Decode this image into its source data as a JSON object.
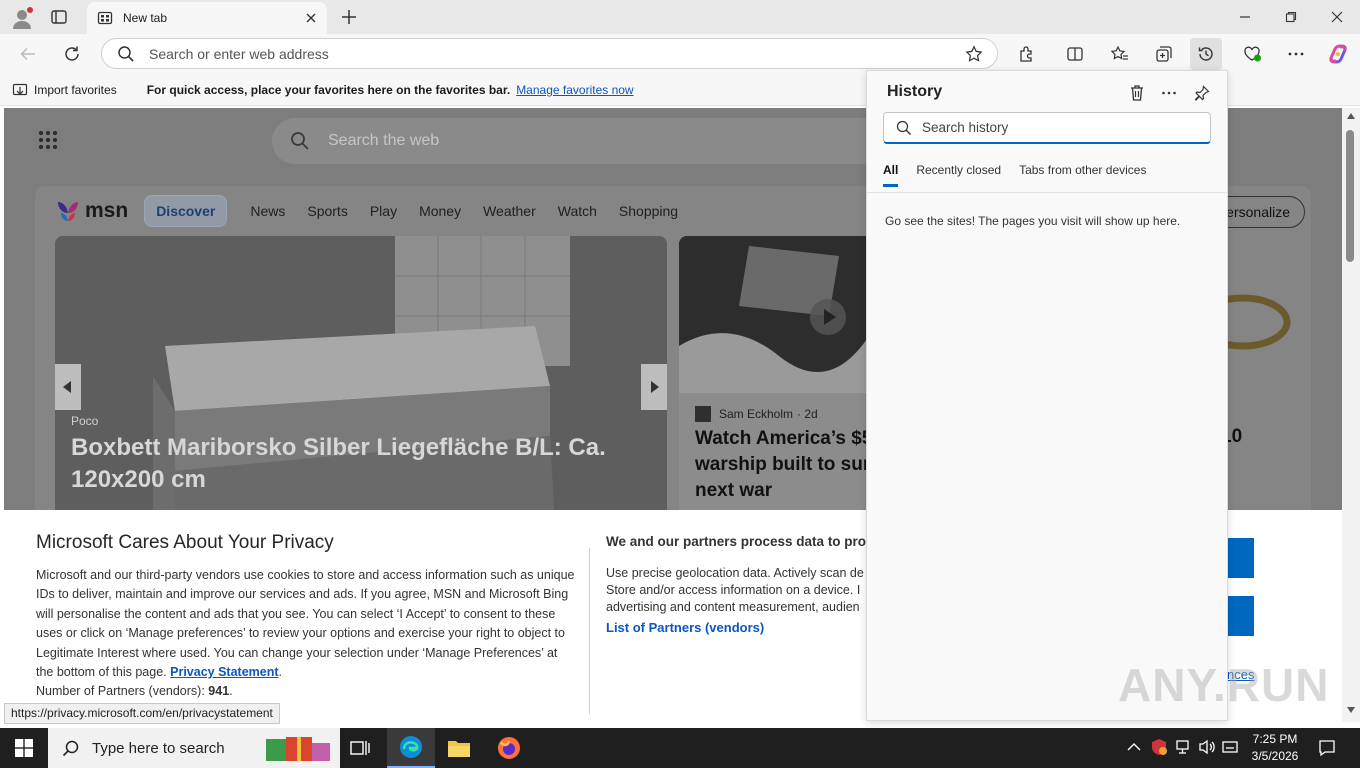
{
  "browser": {
    "tab_title": "New tab",
    "address_placeholder": "Search or enter web address"
  },
  "favorites_bar": {
    "import_label": "Import favorites",
    "message": "For quick access, place your favorites here on the favorites bar.",
    "manage_link": "Manage favorites now"
  },
  "msn": {
    "search_placeholder": "Search the web",
    "logo_text": "msn",
    "nav": [
      "Discover",
      "News",
      "Sports",
      "Play",
      "Money",
      "Weather",
      "Watch",
      "Shopping"
    ],
    "personalize_label": "Personalize",
    "hero": {
      "source": "Poco",
      "title": "Boxbett Mariborsko Silber Liegefläche B/L: Ca. 120x200 cm"
    },
    "video": {
      "author": "Sam Eckholm",
      "age": "· 2d",
      "title_lines": [
        "Watch America’s $5",
        "warship built to sur",
        "next war"
      ]
    },
    "right_card_fragment": "10"
  },
  "privacy": {
    "title": "Microsoft Cares About Your Privacy",
    "body": "Microsoft and our third-party vendors use cookies to store and access information such as unique IDs to deliver, maintain and improve our services and ads. If you agree, MSN and Microsoft Bing will personalise the content and ads that you see. You can select ‘I Accept’ to consent to these uses or click on ‘Manage preferences’ to review your options and exercise your right to object to Legitimate Interest where used.  You can change your selection under ‘Manage Preferences’ at the bottom of this page.",
    "privacy_link": "Privacy Statement",
    "partners_count_label": "Number of Partners (vendors):",
    "partners_count": "941",
    "partners_heading": "We and our partners process data to prov",
    "partners_lines": [
      "Use precise geolocation data. Actively scan de",
      "Store and/or access information on a device. I",
      "advertising and content measurement, audien"
    ],
    "partners_link": "List of Partners (vendors)",
    "prefs_link_fragment": "nces"
  },
  "status_url": "https://privacy.microsoft.com/en/privacystatement",
  "history": {
    "title": "History",
    "search_placeholder": "Search history",
    "tabs": [
      "All",
      "Recently closed",
      "Tabs from other devices"
    ],
    "empty_message": "Go see the sites! The pages you visit will show up here."
  },
  "watermark": "ANY.RUN",
  "taskbar": {
    "search_placeholder": "Type here to search",
    "time": "7:25 PM",
    "date": "3/5/2026"
  },
  "colors": {
    "accent": "#0067c0",
    "link": "#0b57c2",
    "taskbar": "#1f1f1f"
  }
}
